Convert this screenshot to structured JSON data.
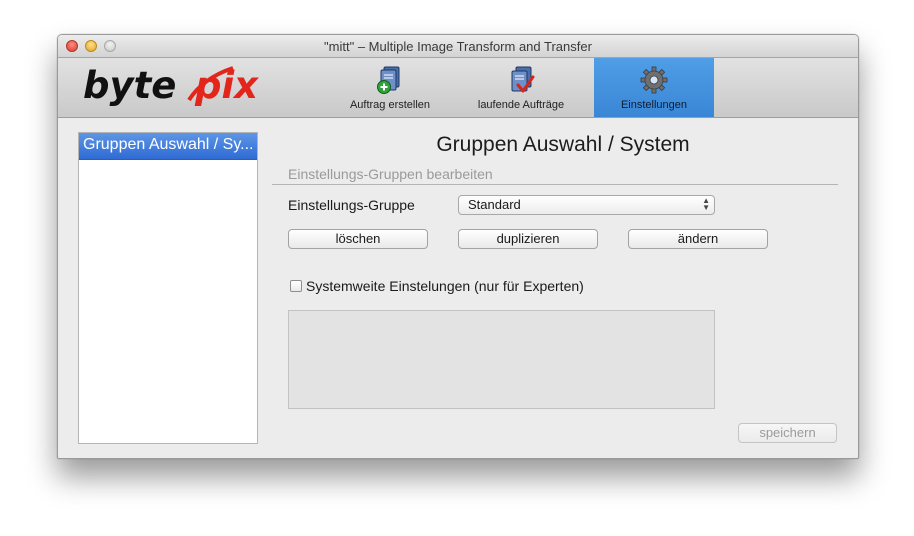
{
  "window": {
    "title": "\"mitt\" – Multiple Image Transform and Transfer"
  },
  "colors": {
    "accent": "#3a86d6",
    "logo_red": "#e3261b",
    "selection": "#3a76d8"
  },
  "toolbar": {
    "logo": {
      "part1": "byte",
      "part2": "pix"
    },
    "buttons": [
      {
        "label": "Auftrag erstellen",
        "icon": "add-document-icon",
        "active": false
      },
      {
        "label": "laufende Aufträge",
        "icon": "checked-documents-icon",
        "active": false
      },
      {
        "label": "Einstellungen",
        "icon": "gear-icon",
        "active": true
      }
    ]
  },
  "sidebar": {
    "items": [
      {
        "label": "Gruppen Auswahl / Sy...",
        "selected": true
      }
    ]
  },
  "main": {
    "title": "Gruppen Auswahl / System",
    "section_label": "Einstellungs-Gruppen bearbeiten",
    "group_field": {
      "label": "Einstellungs-Gruppe",
      "value": "Standard"
    },
    "buttons": {
      "delete": "löschen",
      "duplicate": "duplizieren",
      "change": "ändern"
    },
    "checkbox": {
      "label": "Systemweite Einstelungen (nur für Experten)",
      "checked": false
    },
    "save_button": "speichern"
  }
}
